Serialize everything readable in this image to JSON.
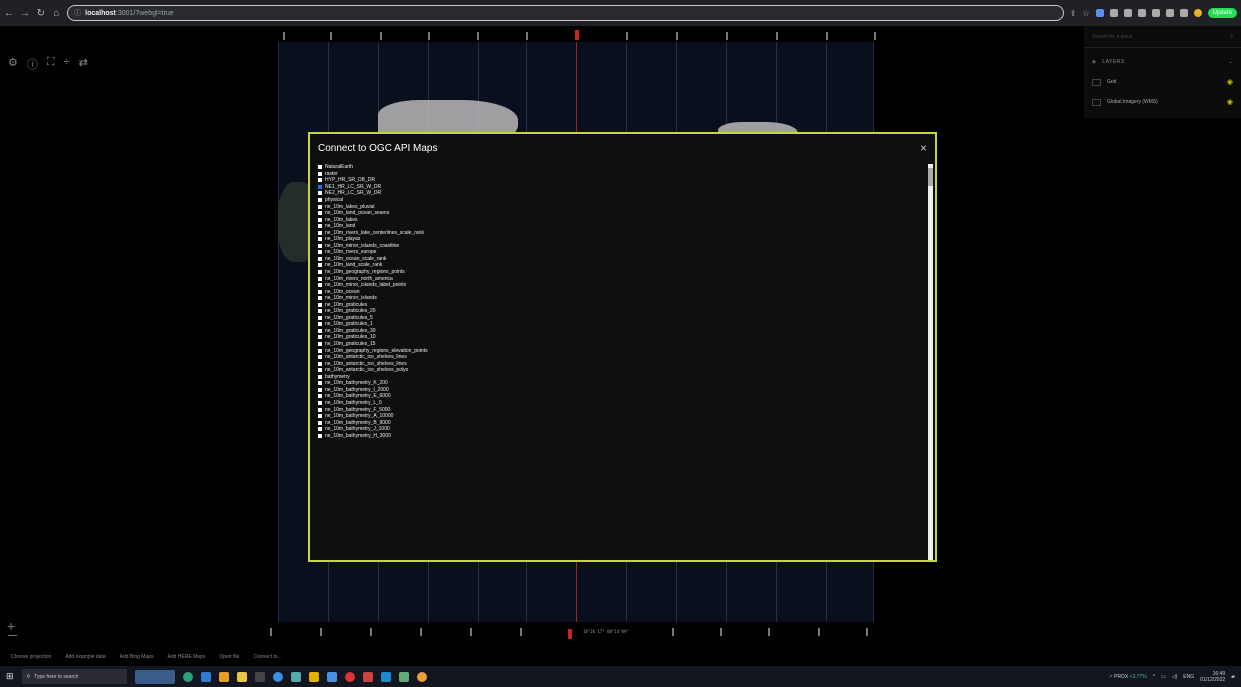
{
  "browser": {
    "url_host": "localhost",
    "url_rest": ":3001/?webgl=true",
    "update_label": "Update"
  },
  "modal": {
    "title": "Connect to OGC API Maps",
    "close_glyph": "×",
    "items": [
      {
        "label": "NaturalEarth",
        "checked": false
      },
      {
        "label": "raster",
        "checked": false
      },
      {
        "label": "HYP_HR_SR_OB_DR",
        "checked": false
      },
      {
        "label": "NE1_HR_LC_SR_W_DR",
        "checked": true
      },
      {
        "label": "NE2_HR_LC_SR_W_DR",
        "checked": false
      },
      {
        "label": "physical",
        "checked": false
      },
      {
        "label": "ne_10m_lakes_pluvial",
        "checked": false
      },
      {
        "label": "ne_10m_land_ocean_seams",
        "checked": false
      },
      {
        "label": "ne_10m_lakes",
        "checked": false
      },
      {
        "label": "ne_10m_land",
        "checked": false
      },
      {
        "label": "ne_10m_rivers_lake_centerlines_scale_rank",
        "checked": false
      },
      {
        "label": "ne_10m_playas",
        "checked": false
      },
      {
        "label": "ne_10m_minor_islands_coastline",
        "checked": false
      },
      {
        "label": "ne_10m_rivers_europe",
        "checked": false
      },
      {
        "label": "ne_10m_ocean_scale_rank",
        "checked": false
      },
      {
        "label": "ne_10m_land_scale_rank",
        "checked": false
      },
      {
        "label": "ne_10m_geography_regions_points",
        "checked": false
      },
      {
        "label": "ne_10m_rivers_north_america",
        "checked": false
      },
      {
        "label": "ne_10m_minor_islands_label_points",
        "checked": false
      },
      {
        "label": "ne_10m_ocean",
        "checked": false
      },
      {
        "label": "ne_10m_minor_islands",
        "checked": false
      },
      {
        "label": "ne_10m_graticules",
        "checked": false
      },
      {
        "label": "ne_10m_graticules_20",
        "checked": false
      },
      {
        "label": "ne_10m_graticules_5",
        "checked": false
      },
      {
        "label": "ne_10m_graticules_1",
        "checked": false
      },
      {
        "label": "ne_10m_graticules_30",
        "checked": false
      },
      {
        "label": "ne_10m_graticules_10",
        "checked": false
      },
      {
        "label": "ne_10m_graticules_15",
        "checked": false
      },
      {
        "label": "ne_10m_geography_regions_elevation_points",
        "checked": false
      },
      {
        "label": "ne_10m_antarctic_ice_shelves_lines",
        "checked": false
      },
      {
        "label": "ne_10m_antarctic_ice_shelves_lines",
        "checked": false
      },
      {
        "label": "ne_10m_antarctic_ice_shelves_polys",
        "checked": false
      },
      {
        "label": "bathymetry",
        "checked": false
      },
      {
        "label": "ne_10m_bathymetry_K_200",
        "checked": false
      },
      {
        "label": "ne_10m_bathymetry_I_2000",
        "checked": false
      },
      {
        "label": "ne_10m_bathymetry_E_6000",
        "checked": false
      },
      {
        "label": "ne_10m_bathymetry_L_0",
        "checked": false
      },
      {
        "label": "ne_10m_bathymetry_F_5000",
        "checked": false
      },
      {
        "label": "ne_10m_bathymetry_A_10000",
        "checked": false
      },
      {
        "label": "ne_10m_bathymetry_B_9000",
        "checked": false
      },
      {
        "label": "ne_10m_bathymetry_J_1000",
        "checked": false
      },
      {
        "label": "ne_10m_bathymetry_H_3000",
        "checked": false
      }
    ]
  },
  "sidebar": {
    "search_placeholder": "Search for a place",
    "layers_heading": "LAYERS",
    "layers": [
      {
        "label": "Grid"
      },
      {
        "label": "Global Imagery (WMS)"
      }
    ]
  },
  "map": {
    "coordinate_readout": "18°26'17\" 00°14'09\"",
    "scale_label": "2000 km"
  },
  "footer": {
    "buttons": [
      "Choose projection",
      "Add example data",
      "Add Bing Maps",
      "Add HERE Maps",
      "Open file",
      "Connect to..."
    ]
  },
  "taskbar": {
    "search_placeholder": "Type here to search",
    "stock_name": "PROX",
    "stock_change": "+3.77%",
    "language": "ENG",
    "time": "16:49",
    "date": "01/12/2022"
  },
  "colors": {
    "modal_border": "#c7d53c",
    "checkbox_checked": "#1a73e8",
    "eye_icon": "#c9c400"
  }
}
